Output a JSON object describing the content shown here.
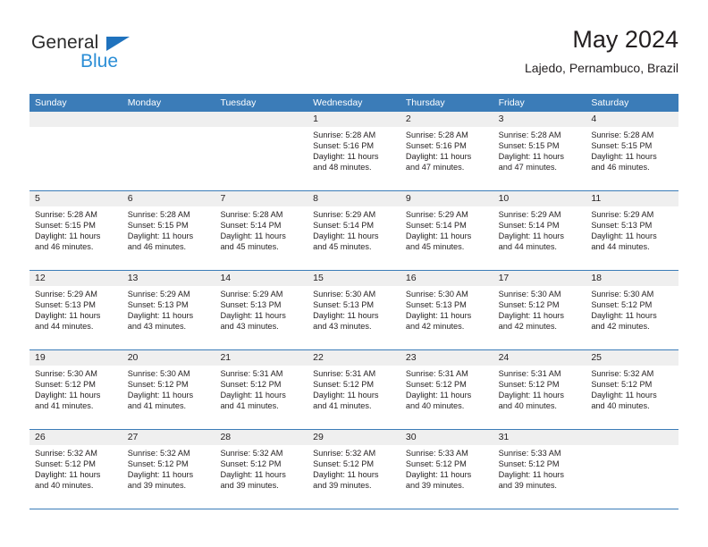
{
  "brand": {
    "name_top": "General",
    "name_bottom": "Blue",
    "color_dark": "#2b2b2b",
    "color_blue": "#2b8ed6",
    "triangle_color": "#1f72bd"
  },
  "header": {
    "title": "May 2024",
    "subtitle": "Lajedo, Pernambuco, Brazil"
  },
  "theme": {
    "header_band": "#3b7cb8",
    "day_number_band": "#efefef",
    "text": "#231f20",
    "row_rule": "#3b7cb8"
  },
  "weekdays": [
    "Sunday",
    "Monday",
    "Tuesday",
    "Wednesday",
    "Thursday",
    "Friday",
    "Saturday"
  ],
  "labels": {
    "sunrise_prefix": "Sunrise:",
    "sunset_prefix": "Sunset:",
    "daylight_prefix": "Daylight:"
  },
  "weeks": [
    [
      {
        "day": "",
        "sunrise": "",
        "sunset": "",
        "daylight_line1": "",
        "daylight_line2": ""
      },
      {
        "day": "",
        "sunrise": "",
        "sunset": "",
        "daylight_line1": "",
        "daylight_line2": ""
      },
      {
        "day": "",
        "sunrise": "",
        "sunset": "",
        "daylight_line1": "",
        "daylight_line2": ""
      },
      {
        "day": "1",
        "sunrise": "Sunrise: 5:28 AM",
        "sunset": "Sunset: 5:16 PM",
        "daylight_line1": "Daylight: 11 hours",
        "daylight_line2": "and 48 minutes."
      },
      {
        "day": "2",
        "sunrise": "Sunrise: 5:28 AM",
        "sunset": "Sunset: 5:16 PM",
        "daylight_line1": "Daylight: 11 hours",
        "daylight_line2": "and 47 minutes."
      },
      {
        "day": "3",
        "sunrise": "Sunrise: 5:28 AM",
        "sunset": "Sunset: 5:15 PM",
        "daylight_line1": "Daylight: 11 hours",
        "daylight_line2": "and 47 minutes."
      },
      {
        "day": "4",
        "sunrise": "Sunrise: 5:28 AM",
        "sunset": "Sunset: 5:15 PM",
        "daylight_line1": "Daylight: 11 hours",
        "daylight_line2": "and 46 minutes."
      }
    ],
    [
      {
        "day": "5",
        "sunrise": "Sunrise: 5:28 AM",
        "sunset": "Sunset: 5:15 PM",
        "daylight_line1": "Daylight: 11 hours",
        "daylight_line2": "and 46 minutes."
      },
      {
        "day": "6",
        "sunrise": "Sunrise: 5:28 AM",
        "sunset": "Sunset: 5:15 PM",
        "daylight_line1": "Daylight: 11 hours",
        "daylight_line2": "and 46 minutes."
      },
      {
        "day": "7",
        "sunrise": "Sunrise: 5:28 AM",
        "sunset": "Sunset: 5:14 PM",
        "daylight_line1": "Daylight: 11 hours",
        "daylight_line2": "and 45 minutes."
      },
      {
        "day": "8",
        "sunrise": "Sunrise: 5:29 AM",
        "sunset": "Sunset: 5:14 PM",
        "daylight_line1": "Daylight: 11 hours",
        "daylight_line2": "and 45 minutes."
      },
      {
        "day": "9",
        "sunrise": "Sunrise: 5:29 AM",
        "sunset": "Sunset: 5:14 PM",
        "daylight_line1": "Daylight: 11 hours",
        "daylight_line2": "and 45 minutes."
      },
      {
        "day": "10",
        "sunrise": "Sunrise: 5:29 AM",
        "sunset": "Sunset: 5:14 PM",
        "daylight_line1": "Daylight: 11 hours",
        "daylight_line2": "and 44 minutes."
      },
      {
        "day": "11",
        "sunrise": "Sunrise: 5:29 AM",
        "sunset": "Sunset: 5:13 PM",
        "daylight_line1": "Daylight: 11 hours",
        "daylight_line2": "and 44 minutes."
      }
    ],
    [
      {
        "day": "12",
        "sunrise": "Sunrise: 5:29 AM",
        "sunset": "Sunset: 5:13 PM",
        "daylight_line1": "Daylight: 11 hours",
        "daylight_line2": "and 44 minutes."
      },
      {
        "day": "13",
        "sunrise": "Sunrise: 5:29 AM",
        "sunset": "Sunset: 5:13 PM",
        "daylight_line1": "Daylight: 11 hours",
        "daylight_line2": "and 43 minutes."
      },
      {
        "day": "14",
        "sunrise": "Sunrise: 5:29 AM",
        "sunset": "Sunset: 5:13 PM",
        "daylight_line1": "Daylight: 11 hours",
        "daylight_line2": "and 43 minutes."
      },
      {
        "day": "15",
        "sunrise": "Sunrise: 5:30 AM",
        "sunset": "Sunset: 5:13 PM",
        "daylight_line1": "Daylight: 11 hours",
        "daylight_line2": "and 43 minutes."
      },
      {
        "day": "16",
        "sunrise": "Sunrise: 5:30 AM",
        "sunset": "Sunset: 5:13 PM",
        "daylight_line1": "Daylight: 11 hours",
        "daylight_line2": "and 42 minutes."
      },
      {
        "day": "17",
        "sunrise": "Sunrise: 5:30 AM",
        "sunset": "Sunset: 5:12 PM",
        "daylight_line1": "Daylight: 11 hours",
        "daylight_line2": "and 42 minutes."
      },
      {
        "day": "18",
        "sunrise": "Sunrise: 5:30 AM",
        "sunset": "Sunset: 5:12 PM",
        "daylight_line1": "Daylight: 11 hours",
        "daylight_line2": "and 42 minutes."
      }
    ],
    [
      {
        "day": "19",
        "sunrise": "Sunrise: 5:30 AM",
        "sunset": "Sunset: 5:12 PM",
        "daylight_line1": "Daylight: 11 hours",
        "daylight_line2": "and 41 minutes."
      },
      {
        "day": "20",
        "sunrise": "Sunrise: 5:30 AM",
        "sunset": "Sunset: 5:12 PM",
        "daylight_line1": "Daylight: 11 hours",
        "daylight_line2": "and 41 minutes."
      },
      {
        "day": "21",
        "sunrise": "Sunrise: 5:31 AM",
        "sunset": "Sunset: 5:12 PM",
        "daylight_line1": "Daylight: 11 hours",
        "daylight_line2": "and 41 minutes."
      },
      {
        "day": "22",
        "sunrise": "Sunrise: 5:31 AM",
        "sunset": "Sunset: 5:12 PM",
        "daylight_line1": "Daylight: 11 hours",
        "daylight_line2": "and 41 minutes."
      },
      {
        "day": "23",
        "sunrise": "Sunrise: 5:31 AM",
        "sunset": "Sunset: 5:12 PM",
        "daylight_line1": "Daylight: 11 hours",
        "daylight_line2": "and 40 minutes."
      },
      {
        "day": "24",
        "sunrise": "Sunrise: 5:31 AM",
        "sunset": "Sunset: 5:12 PM",
        "daylight_line1": "Daylight: 11 hours",
        "daylight_line2": "and 40 minutes."
      },
      {
        "day": "25",
        "sunrise": "Sunrise: 5:32 AM",
        "sunset": "Sunset: 5:12 PM",
        "daylight_line1": "Daylight: 11 hours",
        "daylight_line2": "and 40 minutes."
      }
    ],
    [
      {
        "day": "26",
        "sunrise": "Sunrise: 5:32 AM",
        "sunset": "Sunset: 5:12 PM",
        "daylight_line1": "Daylight: 11 hours",
        "daylight_line2": "and 40 minutes."
      },
      {
        "day": "27",
        "sunrise": "Sunrise: 5:32 AM",
        "sunset": "Sunset: 5:12 PM",
        "daylight_line1": "Daylight: 11 hours",
        "daylight_line2": "and 39 minutes."
      },
      {
        "day": "28",
        "sunrise": "Sunrise: 5:32 AM",
        "sunset": "Sunset: 5:12 PM",
        "daylight_line1": "Daylight: 11 hours",
        "daylight_line2": "and 39 minutes."
      },
      {
        "day": "29",
        "sunrise": "Sunrise: 5:32 AM",
        "sunset": "Sunset: 5:12 PM",
        "daylight_line1": "Daylight: 11 hours",
        "daylight_line2": "and 39 minutes."
      },
      {
        "day": "30",
        "sunrise": "Sunrise: 5:33 AM",
        "sunset": "Sunset: 5:12 PM",
        "daylight_line1": "Daylight: 11 hours",
        "daylight_line2": "and 39 minutes."
      },
      {
        "day": "31",
        "sunrise": "Sunrise: 5:33 AM",
        "sunset": "Sunset: 5:12 PM",
        "daylight_line1": "Daylight: 11 hours",
        "daylight_line2": "and 39 minutes."
      },
      {
        "day": "",
        "sunrise": "",
        "sunset": "",
        "daylight_line1": "",
        "daylight_line2": ""
      }
    ]
  ]
}
